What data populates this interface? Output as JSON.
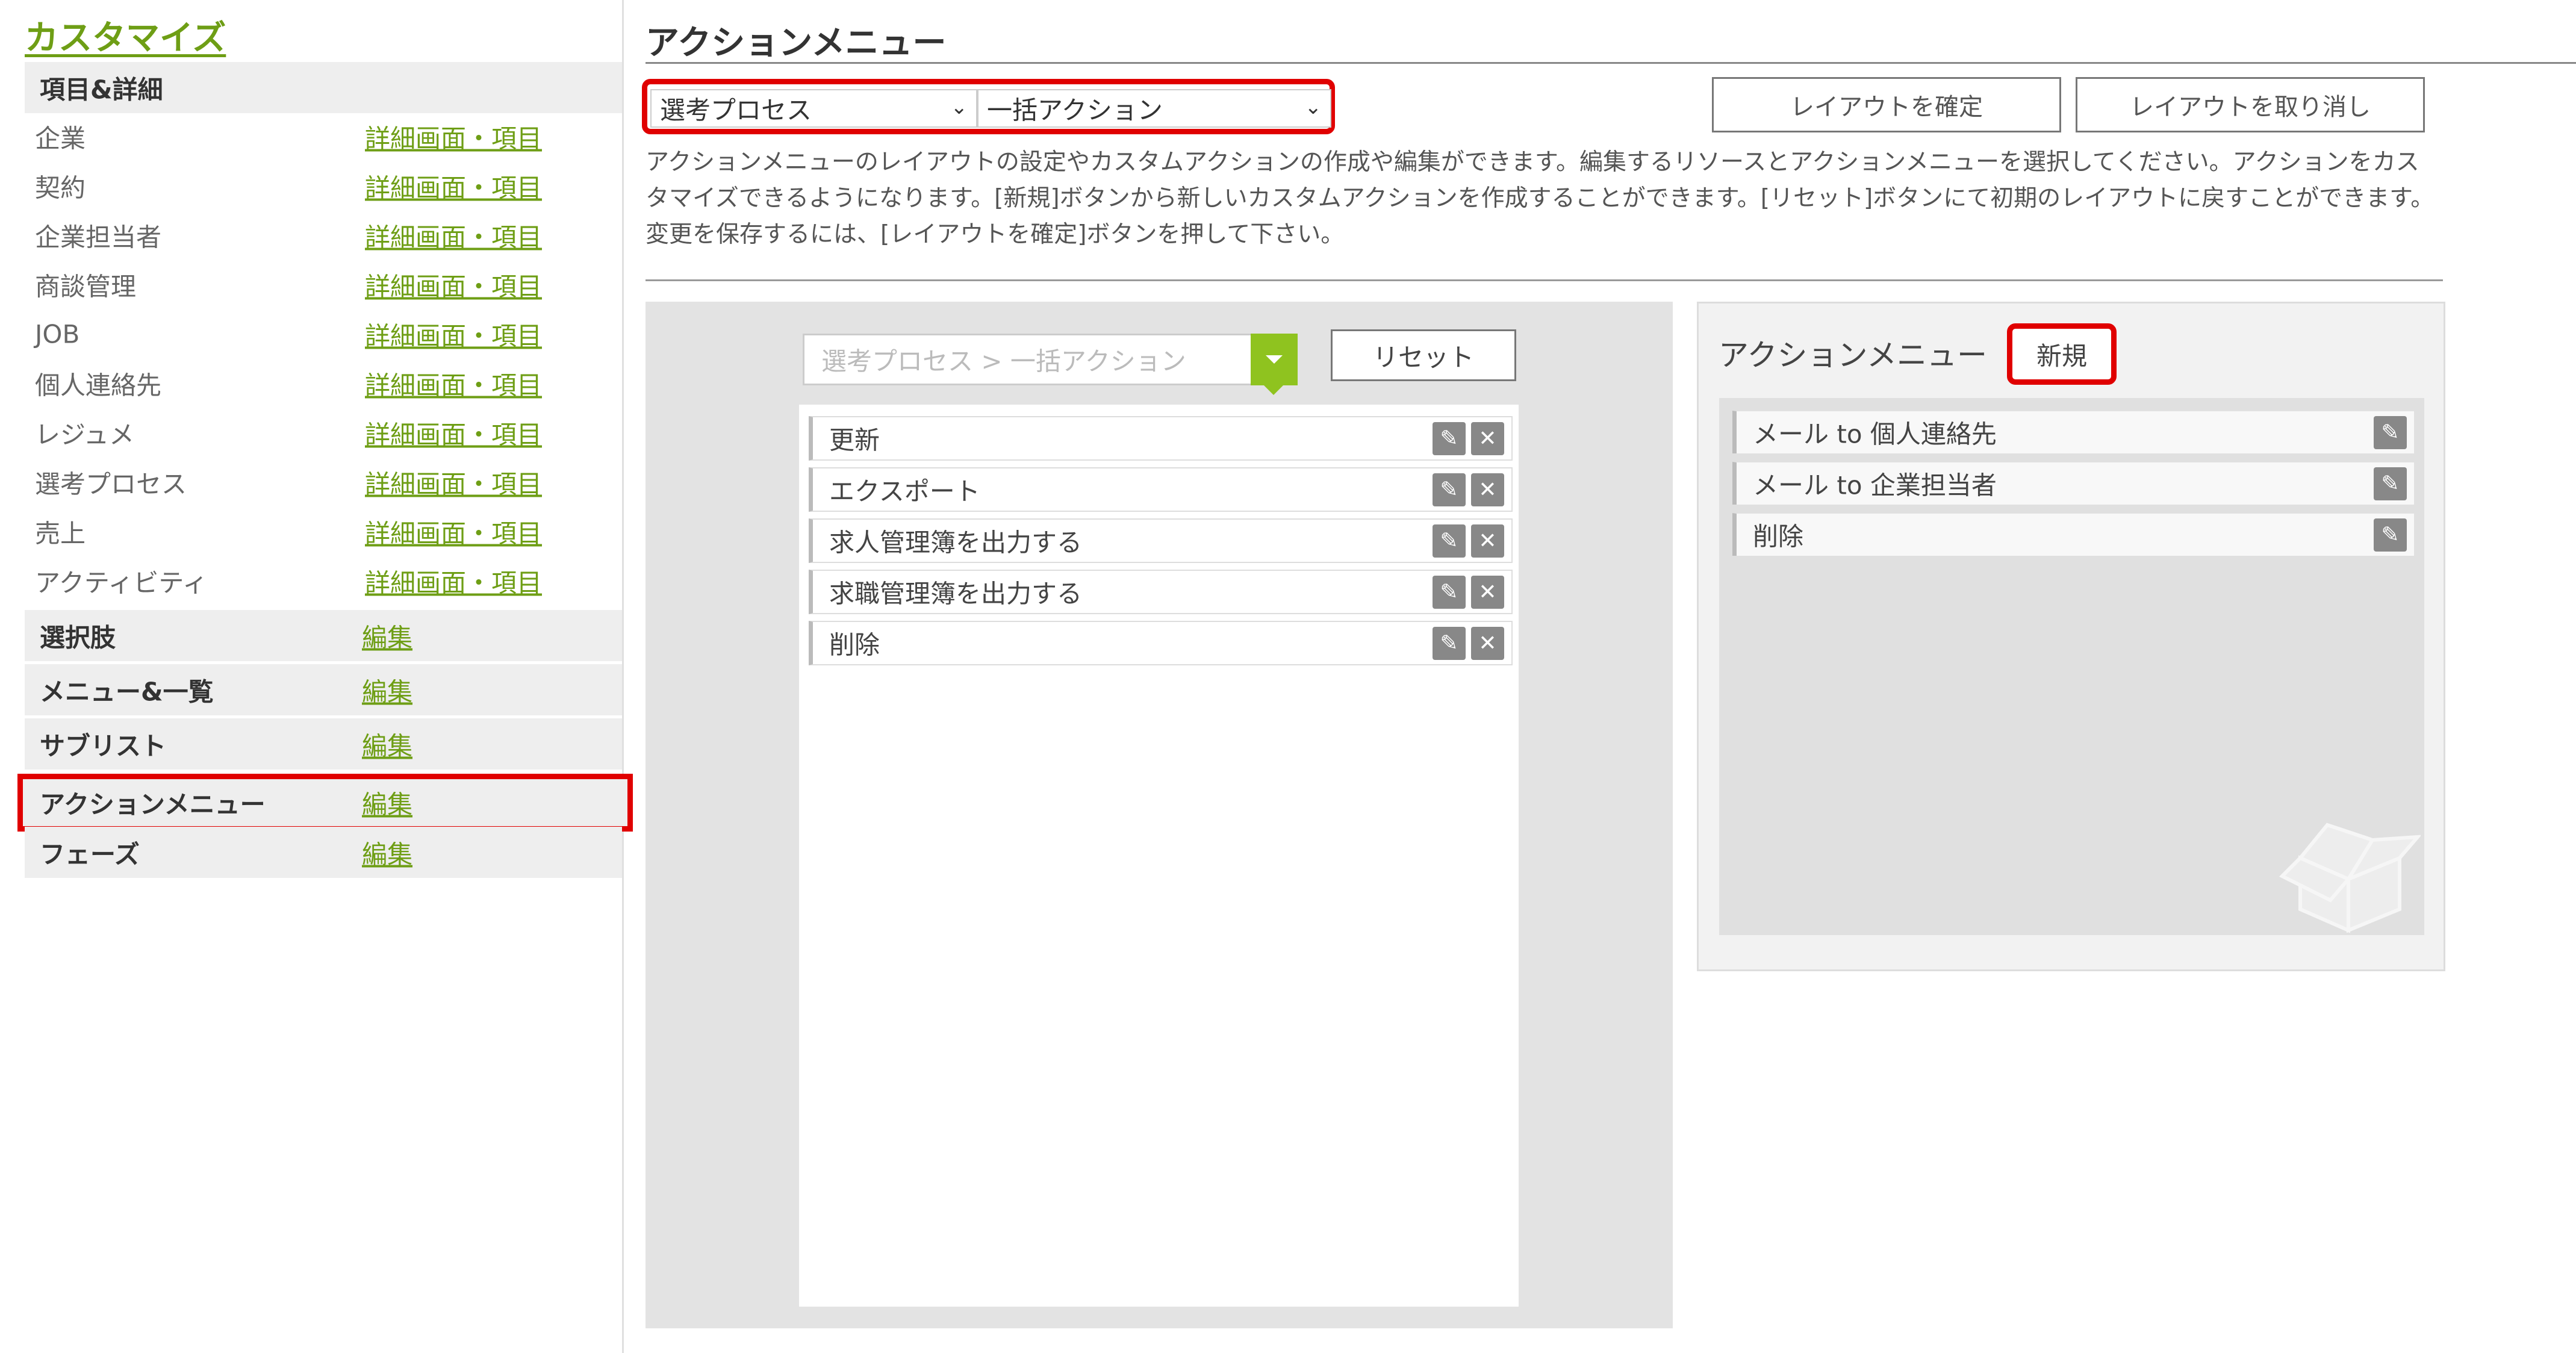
{
  "sidebar": {
    "title": "カスタマイズ",
    "section_items_details": "項目&詳細",
    "items": [
      {
        "label": "企業",
        "link": "詳細画面・項目"
      },
      {
        "label": "契約",
        "link": "詳細画面・項目"
      },
      {
        "label": "企業担当者",
        "link": "詳細画面・項目"
      },
      {
        "label": "商談管理",
        "link": "詳細画面・項目"
      },
      {
        "label": "JOB",
        "link": "詳細画面・項目"
      },
      {
        "label": "個人連絡先",
        "link": "詳細画面・項目"
      },
      {
        "label": "レジュメ",
        "link": "詳細画面・項目"
      },
      {
        "label": "選考プロセス",
        "link": "詳細画面・項目"
      },
      {
        "label": "売上",
        "link": "詳細画面・項目"
      },
      {
        "label": "アクティビティ",
        "link": "詳細画面・項目"
      }
    ],
    "sections": [
      {
        "label": "選択肢",
        "link": "編集"
      },
      {
        "label": "メニュー&一覧",
        "link": "編集"
      },
      {
        "label": "サブリスト",
        "link": "編集"
      },
      {
        "label": "アクションメニュー",
        "link": "編集",
        "active": true
      },
      {
        "label": "フェーズ",
        "link": "編集"
      }
    ]
  },
  "main": {
    "title": "アクションメニュー",
    "resource_select": {
      "value": "選考プロセス"
    },
    "menu_select": {
      "value": "一括アクション"
    },
    "confirm_layout_label": "レイアウトを確定",
    "cancel_layout_label": "レイアウトを取り消し",
    "description": "アクションメニューのレイアウトの設定やカスタムアクションの作成や編集ができます。編集するリソースとアクションメニューを選択してください。アクションをカスタマイズできるようになります。[新規]ボタンから新しいカスタムアクションを作成することができます。[リセット]ボタンにて初期のレイアウトに戻すことができます。変更を保存するには、[レイアウトを確定]ボタンを押して下さい。"
  },
  "editor": {
    "breadcrumb_select": "選考プロセス > 一括アクション",
    "reset_label": "リセット",
    "items": [
      "更新",
      "エクスポート",
      "求人管理簿を出力する",
      "求職管理簿を出力する",
      "削除"
    ]
  },
  "action_panel": {
    "title": "アクションメニュー",
    "new_label": "新規",
    "items": [
      "メール to 個人連絡先",
      "メール to 企業担当者",
      "削除"
    ]
  },
  "colors": {
    "accent_green": "#6e9e15",
    "dropdown_green": "#8fc31f",
    "highlight_red": "#e00000"
  },
  "icons": {
    "edit": "pencil-icon",
    "delete": "close-icon",
    "dropdown": "chevron-down-icon",
    "empty_state": "box-icon"
  }
}
